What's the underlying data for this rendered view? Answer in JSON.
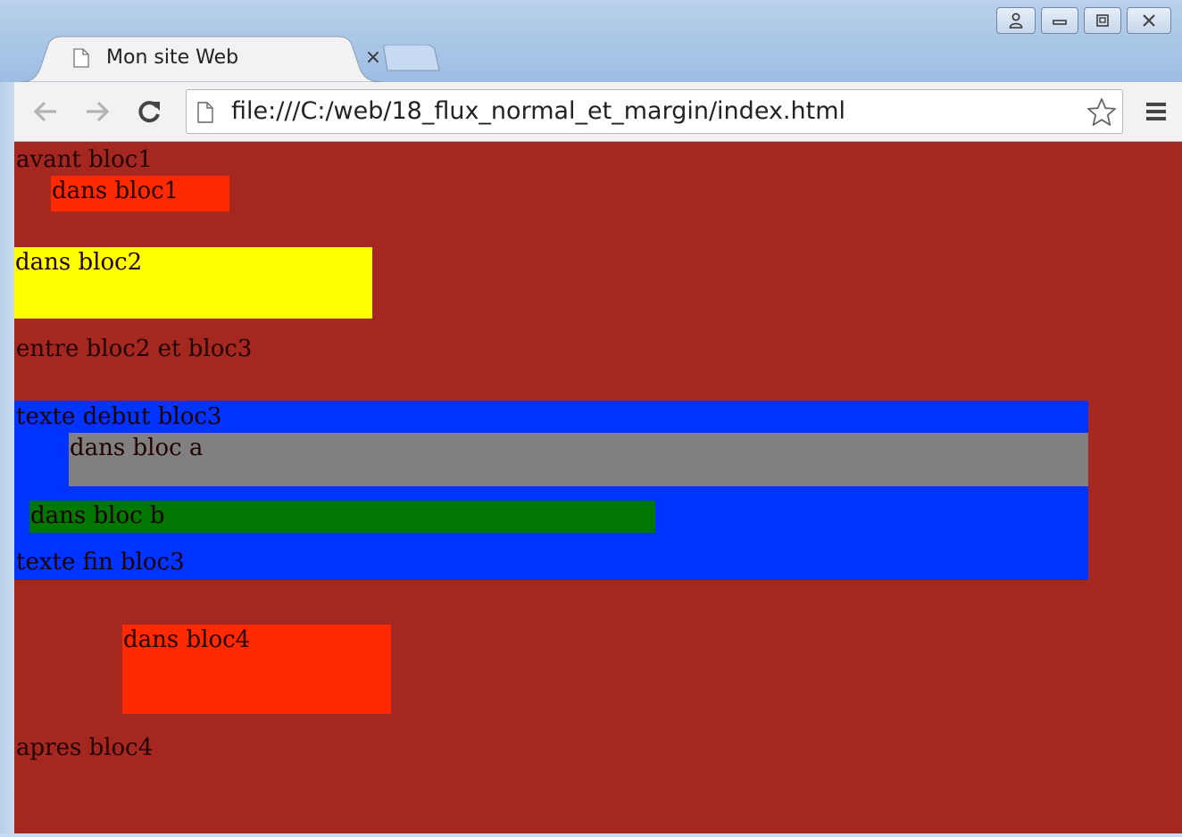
{
  "browser": {
    "tab_title": "Mon site Web",
    "tab_close": "×",
    "url": "file:///C:/web/18_flux_normal_et_margin/index.html"
  },
  "page": {
    "avant_bloc1": "avant bloc1",
    "bloc1": "dans bloc1",
    "bloc2": "dans bloc2",
    "entre": "entre bloc2 et bloc3",
    "bloc3_debut": "texte debut bloc3",
    "bloc_a": "dans bloc a",
    "bloc_b": "dans bloc b",
    "bloc3_fin": "texte fin bloc3",
    "bloc4": "dans bloc4",
    "apres_bloc4": "apres bloc4"
  },
  "colors": {
    "page_background": "#a52820",
    "bloc1": "#ff2a00",
    "bloc2": "#ffff00",
    "bloc3": "#0033ff",
    "bloc_a": "#808080",
    "bloc_b": "#007700",
    "bloc4": "#ff2a00"
  }
}
